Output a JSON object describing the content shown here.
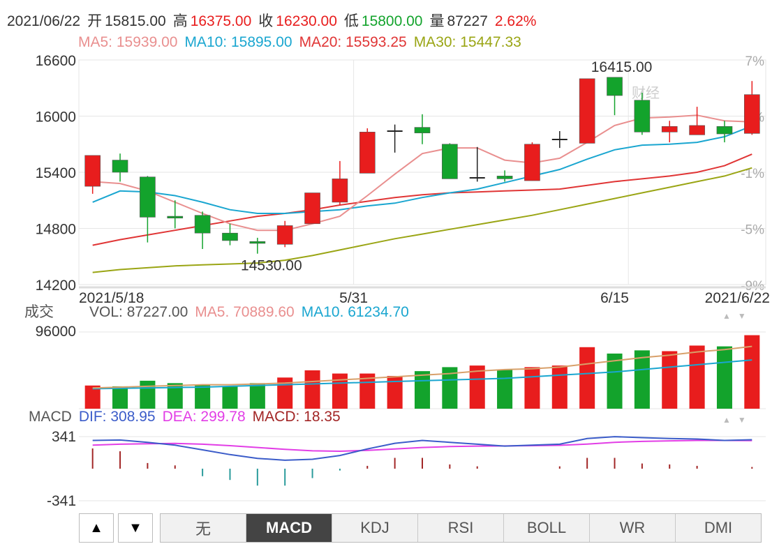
{
  "header": {
    "date": "2021/06/22",
    "open_label": "开",
    "open": "15815.00",
    "high_label": "高",
    "high": "16375.00",
    "close_label": "收",
    "close": "16230.00",
    "low_label": "低",
    "low": "15800.00",
    "vol_label": "量",
    "vol": "87227",
    "change": "2.62%"
  },
  "ma": {
    "ma5": "MA5: 15939.00",
    "ma10": "MA10: 15895.00",
    "ma20": "MA20: 15593.25",
    "ma30": "MA30: 15447.33"
  },
  "volume_header": {
    "label": "成交",
    "vol": "VOL: 87227.00",
    "ma5": "MA5. 70889.60",
    "ma10": "MA10. 61234.70"
  },
  "macd_header": {
    "label": "MACD",
    "dif": "DIF: 308.95",
    "dea": "DEA: 299.78",
    "macd": "MACD: 18.35"
  },
  "watermark": "财经",
  "tabs": [
    "无",
    "MACD",
    "KDJ",
    "RSI",
    "BOLL",
    "WR",
    "DMI"
  ],
  "active_tab": "MACD",
  "nav": {
    "up": "▲",
    "down": "▼"
  },
  "colors": {
    "up": "#e81d1d",
    "down": "#13a32c",
    "ma5": "#e98f8f",
    "ma10": "#1aa6d0",
    "ma20": "#e03535",
    "ma30": "#9aa514",
    "dif": "#3b5cc9",
    "dea": "#e23ee6",
    "macd_bar": "#a22626",
    "grid": "#e6e6e6",
    "text": "#333333"
  },
  "chart_data": {
    "type": "candlestick",
    "price_axis": {
      "ticks": [
        16600,
        16000,
        15400,
        14800,
        14200
      ],
      "ylim": [
        14200,
        16600
      ]
    },
    "pct_axis": {
      "ticks": [
        "7%",
        "3%",
        "-1%",
        "-5%",
        "-9%"
      ]
    },
    "x_labels": [
      "2021/5/18",
      "5/31",
      "6/15",
      "2021/6/22"
    ],
    "annotations": {
      "max": "16415.00",
      "min": "14530.00"
    },
    "candles": [
      {
        "o": 15250,
        "c": 15580,
        "h": 15580,
        "l": 15170
      },
      {
        "o": 15530,
        "c": 15400,
        "h": 15600,
        "l": 15300
      },
      {
        "o": 15350,
        "c": 14920,
        "h": 15360,
        "l": 14650
      },
      {
        "o": 14930,
        "c": 14910,
        "h": 15100,
        "l": 14800
      },
      {
        "o": 14940,
        "c": 14750,
        "h": 14980,
        "l": 14580
      },
      {
        "o": 14750,
        "c": 14670,
        "h": 14850,
        "l": 14620
      },
      {
        "o": 14660,
        "c": 14640,
        "h": 14700,
        "l": 14530
      },
      {
        "o": 14630,
        "c": 14830,
        "h": 14880,
        "l": 14600
      },
      {
        "o": 14850,
        "c": 15180,
        "h": 15180,
        "l": 14850
      },
      {
        "o": 15080,
        "c": 15330,
        "h": 15520,
        "l": 15050
      },
      {
        "o": 15390,
        "c": 15830,
        "h": 15870,
        "l": 15390
      },
      {
        "o": 15840,
        "c": 15840,
        "h": 15910,
        "l": 15610
      },
      {
        "o": 15880,
        "c": 15820,
        "h": 16020,
        "l": 15700
      },
      {
        "o": 15700,
        "c": 15330,
        "h": 15710,
        "l": 15330
      },
      {
        "o": 15340,
        "c": 15340,
        "h": 15670,
        "l": 15300
      },
      {
        "o": 15360,
        "c": 15330,
        "h": 15420,
        "l": 15300
      },
      {
        "o": 15310,
        "c": 15700,
        "h": 15720,
        "l": 15310
      },
      {
        "o": 15750,
        "c": 15750,
        "h": 15840,
        "l": 15660
      },
      {
        "o": 15710,
        "c": 16400,
        "h": 16400,
        "l": 15710
      },
      {
        "o": 16415,
        "c": 16220,
        "h": 16415,
        "l": 16010
      },
      {
        "o": 16170,
        "c": 15830,
        "h": 16250,
        "l": 15800
      },
      {
        "o": 15830,
        "c": 15890,
        "h": 15950,
        "l": 15720
      },
      {
        "o": 15800,
        "c": 15900,
        "h": 16100,
        "l": 15800
      },
      {
        "o": 15890,
        "c": 15810,
        "h": 15950,
        "l": 15720
      },
      {
        "o": 15815,
        "c": 16230,
        "h": 16375,
        "l": 15800
      }
    ],
    "ma5": [
      15300,
      15280,
      15200,
      15080,
      14960,
      14850,
      14780,
      14780,
      14850,
      14930,
      15150,
      15380,
      15600,
      15660,
      15660,
      15530,
      15500,
      15550,
      15720,
      15900,
      15980,
      15990,
      16010,
      15950,
      15939
    ],
    "ma10": [
      15080,
      15200,
      15190,
      15150,
      15080,
      15000,
      14960,
      14960,
      14980,
      15000,
      15040,
      15070,
      15130,
      15180,
      15220,
      15290,
      15360,
      15430,
      15540,
      15640,
      15690,
      15700,
      15720,
      15780,
      15895
    ],
    "ma20": [
      14620,
      14680,
      14730,
      14780,
      14830,
      14880,
      14930,
      14960,
      15000,
      15050,
      15090,
      15130,
      15160,
      15180,
      15190,
      15200,
      15210,
      15220,
      15260,
      15300,
      15330,
      15360,
      15400,
      15470,
      15593
    ],
    "ma30": [
      14330,
      14360,
      14380,
      14400,
      14410,
      14420,
      14430,
      14460,
      14510,
      14570,
      14630,
      14690,
      14740,
      14790,
      14840,
      14890,
      14940,
      15000,
      15060,
      15120,
      15180,
      15240,
      15300,
      15360,
      15447
    ],
    "volume": {
      "ticks": [
        96000
      ],
      "ymax": 96000,
      "values": [
        29000,
        28000,
        35000,
        32000,
        30000,
        28000,
        32000,
        39000,
        48000,
        44000,
        44000,
        41000,
        47000,
        52000,
        54000,
        49000,
        52000,
        54000,
        77000,
        69000,
        73000,
        72000,
        79000,
        78000,
        92000
      ],
      "ma5": [
        26000,
        27000,
        28000,
        29000,
        30000,
        30000,
        31000,
        32000,
        34000,
        36000,
        38000,
        40000,
        42000,
        44000,
        47000,
        49000,
        50000,
        52000,
        56000,
        60000,
        64000,
        67000,
        71000,
        74000,
        78000
      ],
      "ma10": [
        25000,
        25500,
        26000,
        26500,
        27000,
        28000,
        29000,
        30000,
        31000,
        32000,
        33000,
        34000,
        35000,
        36000,
        37000,
        38000,
        40000,
        42000,
        44000,
        46000,
        49000,
        52000,
        55000,
        58000,
        61000
      ]
    },
    "macd": {
      "ticks": [
        341,
        -341
      ],
      "ylim": [
        -341,
        341
      ],
      "dif": [
        300,
        305,
        280,
        250,
        200,
        150,
        110,
        90,
        100,
        140,
        210,
        270,
        300,
        280,
        260,
        240,
        250,
        260,
        320,
        340,
        330,
        320,
        315,
        300,
        308
      ],
      "dea": [
        250,
        260,
        265,
        268,
        260,
        245,
        225,
        205,
        190,
        185,
        195,
        210,
        225,
        235,
        240,
        242,
        245,
        248,
        262,
        280,
        290,
        296,
        300,
        300,
        299
      ],
      "bars": [
        215,
        185,
        60,
        35,
        -80,
        -120,
        -180,
        -180,
        -100,
        -20,
        30,
        115,
        115,
        45,
        25,
        0,
        0,
        25,
        115,
        115,
        55,
        45,
        30,
        0,
        18
      ]
    }
  }
}
